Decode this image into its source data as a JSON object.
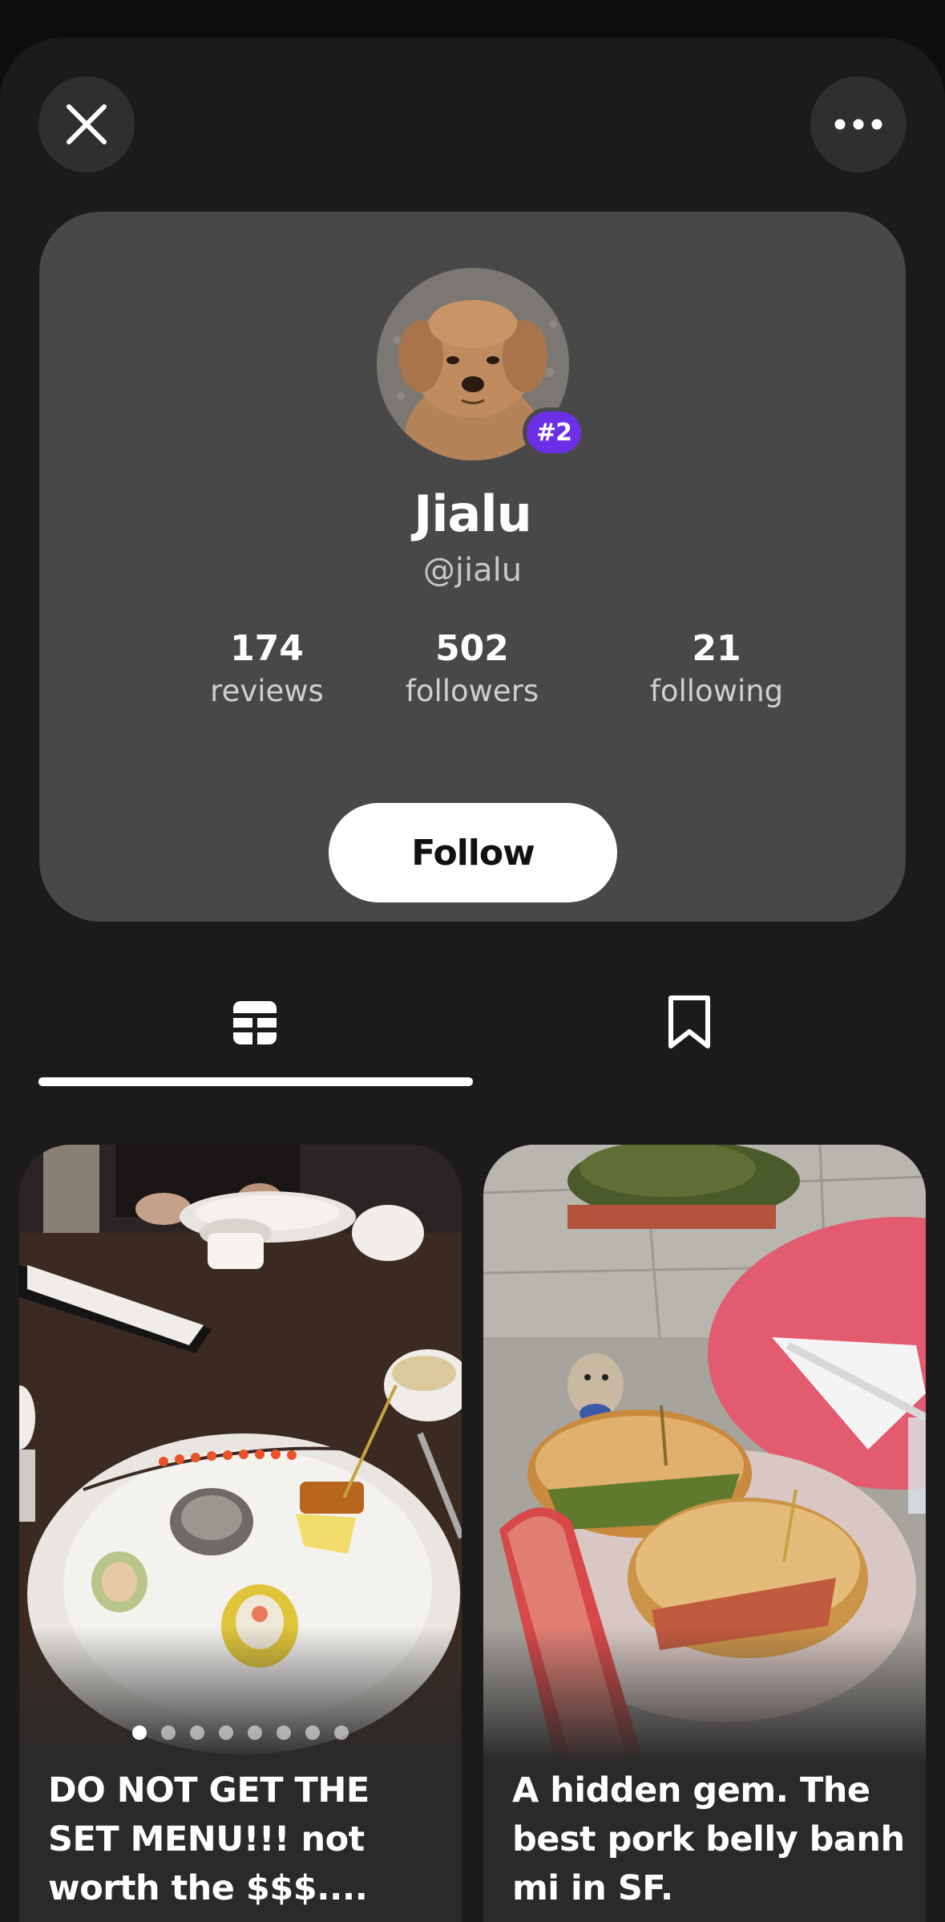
{
  "header": {
    "close_icon": "close-icon",
    "more_icon": "more-horizontal-icon"
  },
  "profile": {
    "rank_badge": "#2",
    "name": "Jialu",
    "handle": "@jialu",
    "stats": [
      {
        "value": "174",
        "label": "reviews"
      },
      {
        "value": "502",
        "label": "followers"
      },
      {
        "value": "21",
        "label": "following"
      }
    ],
    "follow_label": "Follow"
  },
  "tabs": [
    {
      "icon": "grid-icon",
      "selected": true
    },
    {
      "icon": "bookmark-icon",
      "selected": false
    }
  ],
  "posts": [
    {
      "caption": "DO NOT GET THE SET MENU!!! not worth the $$$....",
      "image_count": 8,
      "active_image": 1
    },
    {
      "caption": "A hidden gem. The best pork belly banh mi in SF."
    }
  ],
  "colors": {
    "rank_badge": "#6b2fe6",
    "card": "#484848",
    "background": "#1b1b1c"
  }
}
